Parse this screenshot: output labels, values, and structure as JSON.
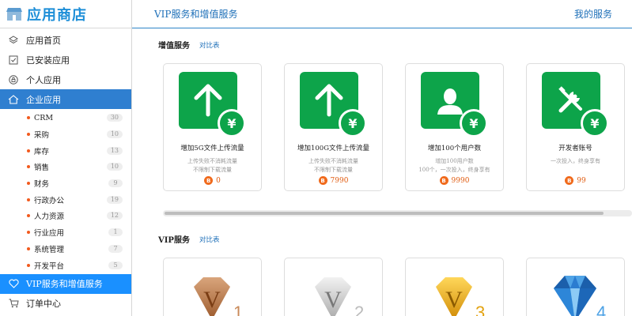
{
  "logo": {
    "text": "应用商店",
    "icon": "store-icon"
  },
  "sidebar": {
    "items": [
      {
        "label": "应用首页",
        "icon": "layers-icon"
      },
      {
        "label": "已安装应用",
        "icon": "checkbox-icon"
      },
      {
        "label": "个人应用",
        "icon": "lock-icon"
      },
      {
        "label": "企业应用",
        "icon": "house-icon"
      }
    ],
    "subitems": [
      {
        "label": "CRM",
        "count": "30"
      },
      {
        "label": "采购",
        "count": "10"
      },
      {
        "label": "库存",
        "count": "13"
      },
      {
        "label": "销售",
        "count": "10"
      },
      {
        "label": "财务",
        "count": "9"
      },
      {
        "label": "行政办公",
        "count": "19"
      },
      {
        "label": "人力资源",
        "count": "12"
      },
      {
        "label": "行业应用",
        "count": "1"
      },
      {
        "label": "系统管理",
        "count": "7"
      },
      {
        "label": "开发平台",
        "count": "5"
      }
    ],
    "bottom_items": [
      {
        "label": "VIP服务和增值服务",
        "icon": "heart-icon"
      },
      {
        "label": "订单中心",
        "icon": "cart-icon"
      }
    ]
  },
  "header": {
    "title": "VIP服务和增值服务",
    "link": "我的服务"
  },
  "value_section": {
    "title": "增值服务",
    "compare": "对比表",
    "cards": [
      {
        "name": "增加5G文件上传流量",
        "desc": "上传失败不消耗流量\n不限制下载流量",
        "price": "0",
        "icon": "upload-arrow-icon"
      },
      {
        "name": "增加100G文件上传流量",
        "desc": "上传失败不消耗流量\n不限制下载流量",
        "price": "7990",
        "icon": "upload-arrow-icon"
      },
      {
        "name": "增加100个用户数",
        "desc": "增加100用户数\n100个，一次投入，终身享有",
        "price": "9990",
        "icon": "user-icon"
      },
      {
        "name": "开发者账号",
        "desc": "一次投入，终身享有",
        "price": "99",
        "icon": "tools-icon"
      }
    ],
    "price_coin": "B",
    "yen": "¥"
  },
  "vip_section": {
    "title": "VIP服务",
    "compare": "对比表",
    "levels": [
      {
        "letter": "V",
        "level": "1",
        "color": "#b8743f"
      },
      {
        "letter": "V",
        "level": "2",
        "color": "#b5b5b5"
      },
      {
        "letter": "V",
        "level": "3",
        "color": "#e3a20f"
      },
      {
        "letter": "",
        "level": "4",
        "color": "#2574c9"
      }
    ]
  }
}
